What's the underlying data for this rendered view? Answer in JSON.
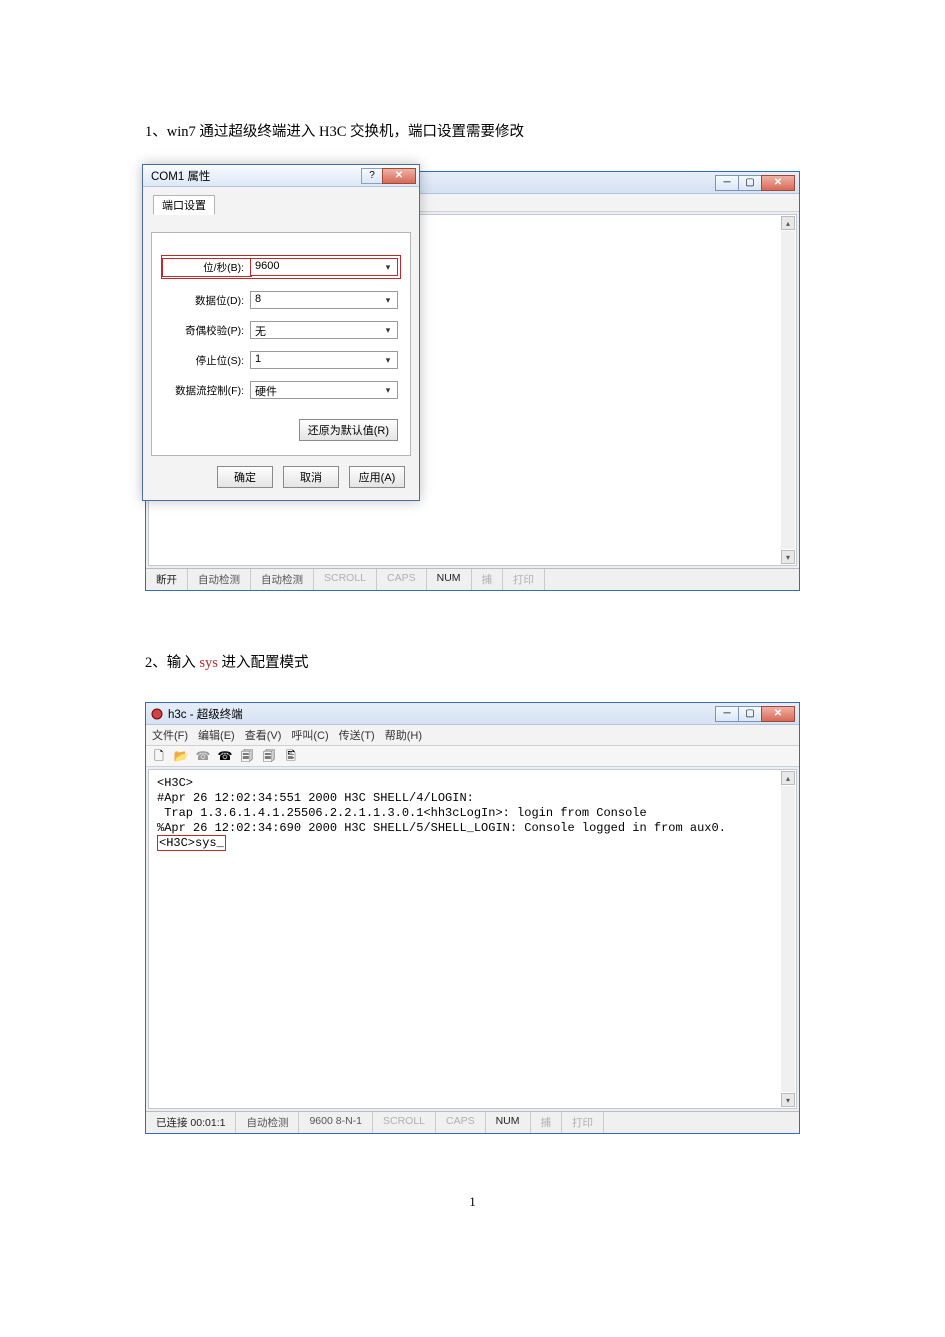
{
  "page_number": "1",
  "step1": {
    "num": "1、",
    "text_before": "win7 通过超级终端进入 H3C 交换机，端口设置需要修改"
  },
  "step2": {
    "num": "2、",
    "text_before": "输入 ",
    "red": "sys",
    "text_after": " 进入配置模式"
  },
  "dialog": {
    "title": "COM1 属性",
    "tab": "端口设置",
    "fields": {
      "baud_label": "位/秒(B):",
      "baud_value": "9600",
      "databits_label": "数据位(D):",
      "databits_value": "8",
      "parity_label": "奇偶校验(P):",
      "parity_value": "无",
      "stopbits_label": "停止位(S):",
      "stopbits_value": "1",
      "flow_label": "数据流控制(F):",
      "flow_value": "硬件"
    },
    "defaults_btn": "还原为默认值(R)",
    "ok": "确定",
    "cancel": "取消",
    "apply": "应用(A)"
  },
  "win1": {
    "title": "",
    "status": {
      "conn": "断开",
      "det1": "自动检测",
      "det2": "自动检测",
      "scroll": "SCROLL",
      "caps": "CAPS",
      "num": "NUM",
      "capture": "捕",
      "print": "打印"
    }
  },
  "win2": {
    "title": "h3c - 超级终端",
    "menu": {
      "file": "文件(F)",
      "edit": "编辑(E)",
      "view": "查看(V)",
      "call": "呼叫(C)",
      "transfer": "传送(T)",
      "help": "帮助(H)"
    },
    "term_lines": [
      "<H3C>",
      "#Apr 26 12:02:34:551 2000 H3C SHELL/4/LOGIN:",
      " Trap 1.3.6.1.4.1.25506.2.2.1.1.3.0.1<hh3cLogIn>: login from Console",
      "%Apr 26 12:02:34:690 2000 H3C SHELL/5/SHELL_LOGIN: Console logged in from aux0.",
      "<H3C>sys_"
    ],
    "status": {
      "conn": "已连接 00:01:1",
      "det1": "自动检测",
      "det2": "9600 8-N-1",
      "scroll": "SCROLL",
      "caps": "CAPS",
      "num": "NUM",
      "capture": "捕",
      "print": "打印"
    }
  }
}
